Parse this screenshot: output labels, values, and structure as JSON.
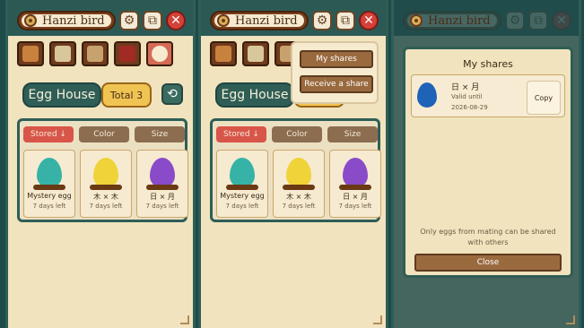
{
  "header": {
    "title": "Hanzi bird",
    "gear_icon": "gear-icon",
    "copy_icon": "copy-icon",
    "close_icon": "close-icon"
  },
  "icon_bar": [
    "house-icon",
    "magnifier-icon",
    "jar-icon",
    "door-icon",
    "egg-icon"
  ],
  "house": {
    "label": "Egg House",
    "total": "Total 3"
  },
  "sort_buttons": [
    "Stored ↓",
    "Color",
    "Size"
  ],
  "eggs": [
    {
      "name": "Mystery egg",
      "days": "7 days left",
      "color": "#36b3a6"
    },
    {
      "name": "木 × 木",
      "days": "7 days left",
      "color": "#f0d338"
    },
    {
      "name": "日 × 月",
      "days": "7 days left",
      "color": "#8a4bc8"
    }
  ],
  "dropdown": {
    "items": [
      "My shares",
      "Receive a share"
    ]
  },
  "modal": {
    "title": "My shares",
    "share": {
      "name": "日 × 月",
      "valid_label": "Valid until",
      "date": "2026-08-29",
      "copy": "Copy",
      "color": "#1f63b8"
    },
    "note": "Only eggs from mating can be shared with others",
    "close": "Close"
  },
  "colors": {
    "teal_dark": "#2b5a55",
    "parchment": "#f1e3bd",
    "active_red": "#d8554a",
    "gold": "#f0c453"
  }
}
